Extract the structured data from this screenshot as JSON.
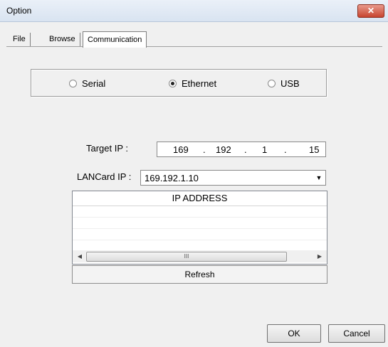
{
  "window": {
    "title": "Option",
    "close_glyph": "✕"
  },
  "tabs": [
    {
      "label": "File"
    },
    {
      "label": "Browse"
    },
    {
      "label": "Communication",
      "selected": true
    }
  ],
  "connection": {
    "options": [
      {
        "label": "Serial",
        "selected": false
      },
      {
        "label": "Ethernet",
        "selected": true
      },
      {
        "label": "USB",
        "selected": false
      }
    ]
  },
  "target_ip": {
    "label": "Target IP :",
    "octets": [
      "169",
      "192",
      "1",
      "15"
    ],
    "separator": "."
  },
  "lancard": {
    "label": "LANCard IP :",
    "value": "169.192.1.10",
    "arrow_glyph": "▼"
  },
  "ip_list": {
    "header": "IP ADDRESS",
    "rows": [],
    "scroll_left_glyph": "◀",
    "scroll_right_glyph": "▶",
    "thumb_grip": "III"
  },
  "buttons": {
    "refresh": "Refresh",
    "ok": "OK",
    "cancel": "Cancel"
  },
  "icons": {
    "close": "close-icon",
    "dropdown": "chevron-down-icon"
  },
  "colors": {
    "title_bar": "#dbe6f3",
    "close": "#c7442f",
    "panel": "#f0f0f0"
  }
}
